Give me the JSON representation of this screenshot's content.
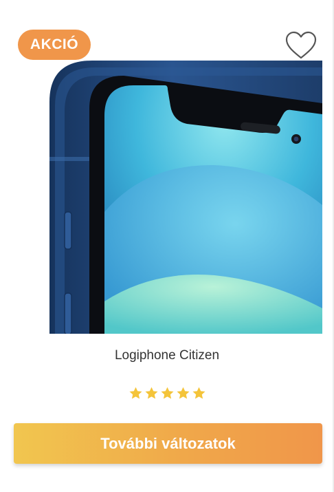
{
  "product": {
    "badge": "AKCIÓ",
    "name": "Logiphone Citizen",
    "rating": 5,
    "rating_max": 5,
    "cta_label": "További változatok"
  },
  "icons": {
    "wishlist": "heart-outline-icon",
    "star": "star-icon"
  },
  "colors": {
    "badge_bg": "#f0964a",
    "star": "#f4c43a",
    "cta_start": "#f1c64f",
    "cta_end": "#f0964a",
    "phone_frame": "#1f3f6e"
  }
}
